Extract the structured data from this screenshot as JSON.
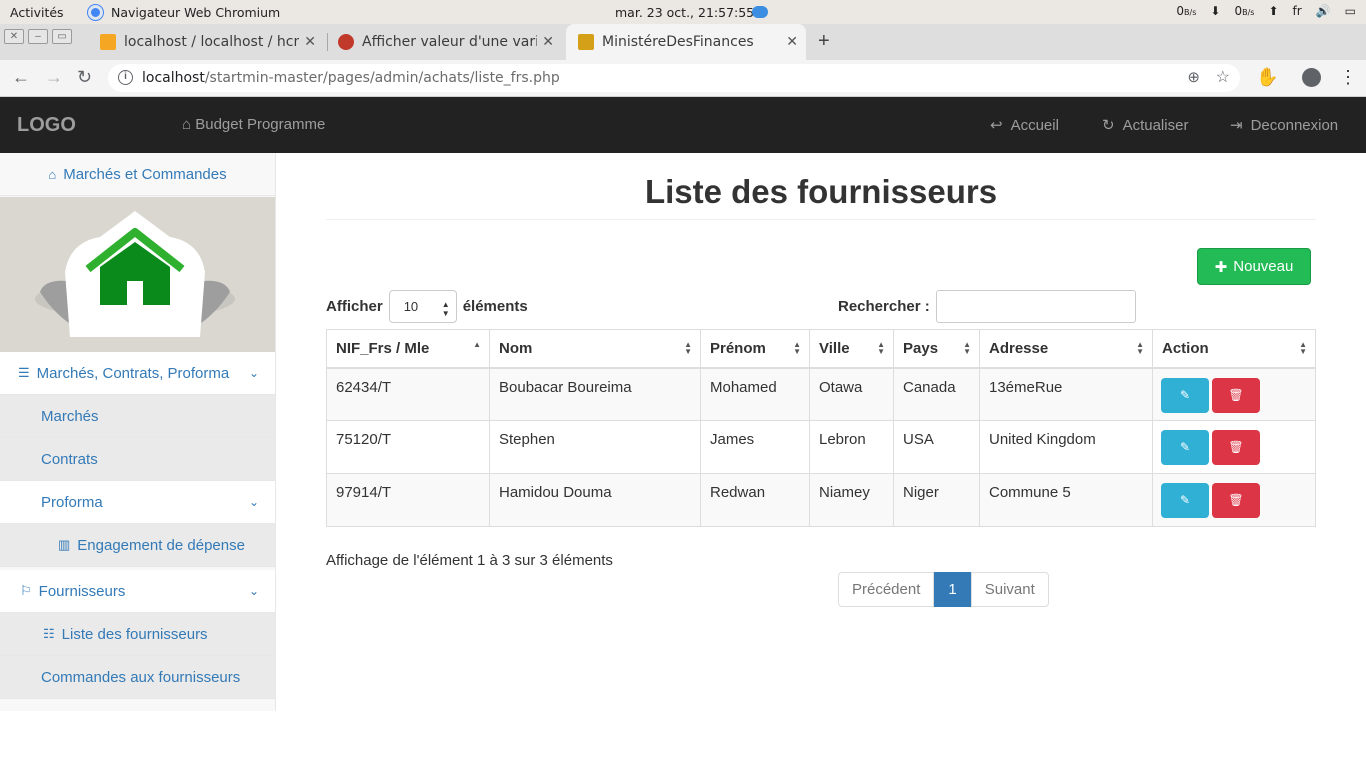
{
  "system_bar": {
    "activities": "Activités",
    "app_name": "Navigateur Web Chromium",
    "clock": "mar. 23 oct., 21:57:55",
    "net_down": "0",
    "net_down_unit": "B/s",
    "net_up": "0",
    "net_up_unit": "B/s",
    "lang": "fr"
  },
  "browser": {
    "tabs": [
      {
        "title": "localhost / localhost / hcm",
        "active": false
      },
      {
        "title": "Afficher valeur d'une variabl",
        "active": false
      },
      {
        "title": "MinistéreDesFinances",
        "active": true
      }
    ],
    "url_host": "localhost",
    "url_path": "/startmin-master/pages/admin/achats/liste_frs.php"
  },
  "navbar": {
    "logo": "LOGO",
    "brand": "Budget Programme",
    "accueil": "Accueil",
    "actualiser": "Actualiser",
    "deconnexion": "Deconnexion"
  },
  "sidebar": {
    "home_link": "Marchés et Commandes",
    "section_contracts": "Marchés, Contrats, Proforma",
    "marches": "Marchés",
    "contrats": "Contrats",
    "proforma": "Proforma",
    "engagement": "Engagement de dépense",
    "fournisseurs": "Fournisseurs",
    "liste_fournisseurs": "Liste des fournisseurs",
    "commandes": "Commandes aux fournisseurs"
  },
  "main": {
    "title": "Liste des fournisseurs",
    "new_button": "Nouveau",
    "show_label": "Afficher",
    "page_length": "10",
    "elements_label": "éléments",
    "search_label": "Rechercher :",
    "columns": [
      "NIF_Frs / Mle",
      "Nom",
      "Prénom",
      "Ville",
      "Pays",
      "Adresse",
      "Action"
    ],
    "rows": [
      [
        "62434/T",
        "Boubacar Boureima",
        "Mohamed",
        "Otawa",
        "Canada",
        "13émeRue"
      ],
      [
        "75120/T",
        "Stephen",
        "James",
        "Lebron",
        "USA",
        "United Kingdom"
      ],
      [
        "97914/T",
        "Hamidou Douma",
        "Redwan",
        "Niamey",
        "Niger",
        "Commune 5"
      ]
    ],
    "info": "Affichage de l'élément 1 à 3 sur 3 éléments",
    "pager": {
      "prev": "Précédent",
      "current": "1",
      "next": "Suivant"
    }
  }
}
